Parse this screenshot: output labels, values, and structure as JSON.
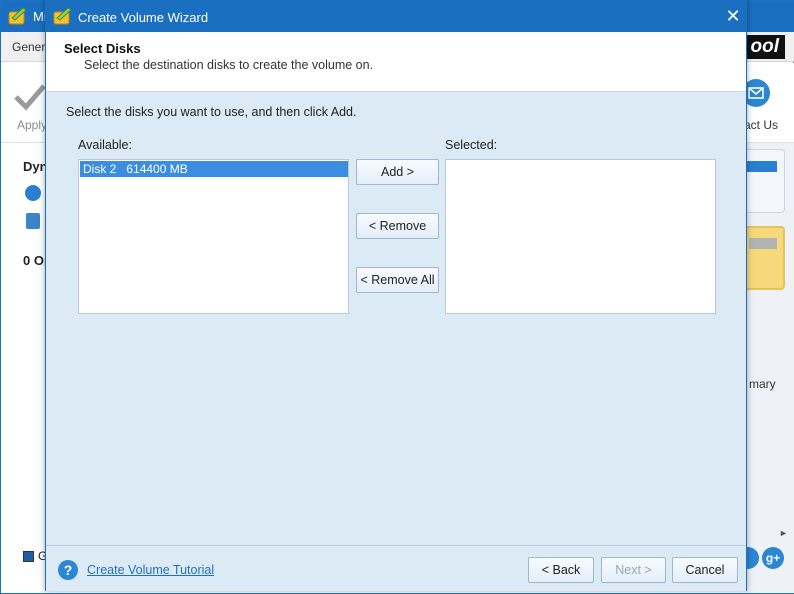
{
  "background_app": {
    "title": "Mi",
    "menu_general": "Gener",
    "logo_text": "ool",
    "apply_label": "Apply",
    "contact_label": "act Us",
    "left_heading": "Dyn",
    "ops_label": "0 Op",
    "legend_g": "G",
    "right_partial": "mary",
    "gplus_label": "g+"
  },
  "dialog": {
    "title": "Create Volume Wizard",
    "close_glyph": "✕",
    "header": {
      "title": "Select Disks",
      "subtitle": "Select the destination disks to create the volume on."
    },
    "instruction": "Select the disks you want to use, and then click Add.",
    "available_label": "Available:",
    "selected_label": "Selected:",
    "available_items": [
      {
        "label": "Disk 2   614400 MB",
        "selected": true
      }
    ],
    "selected_items": [],
    "buttons": {
      "add": "Add >",
      "remove": "< Remove",
      "remove_all": "< Remove All"
    },
    "footer": {
      "help_glyph": "?",
      "tutorial_link": "Create Volume Tutorial",
      "back": "< Back",
      "next": "Next >",
      "cancel": "Cancel",
      "next_enabled": false
    }
  },
  "colors": {
    "titlebar": "#1b6fc0",
    "dialog_body": "#dceaf6",
    "selection": "#3b8de0",
    "link": "#1f6fc0"
  }
}
